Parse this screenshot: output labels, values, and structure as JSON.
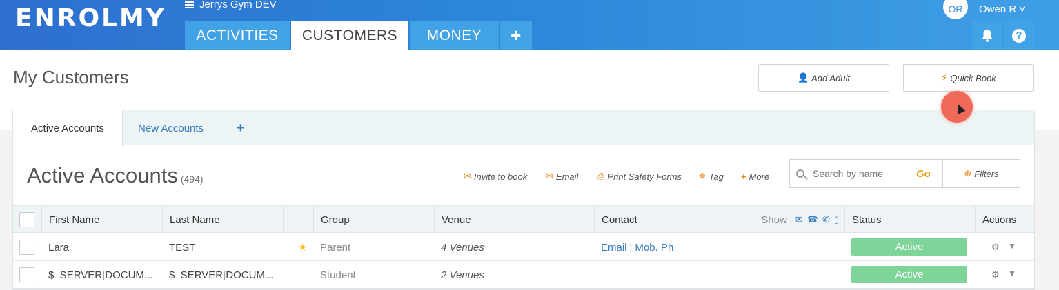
{
  "header": {
    "logo": "ENROLMY",
    "org_name": "Jerrys Gym DEV",
    "tabs": [
      {
        "label": "ACTIVITIES",
        "active": false
      },
      {
        "label": "CUSTOMERS",
        "active": true
      },
      {
        "label": "MONEY",
        "active": false
      }
    ],
    "add_tab_label": "+",
    "user_initials": "OR",
    "user_name": "Owen R",
    "help_label": "?"
  },
  "page": {
    "title": "My Customers",
    "add_adult_label": "Add Adult",
    "quick_book_label": "Quick Book"
  },
  "subtabs": {
    "items": [
      {
        "label": "Active Accounts",
        "active": true
      },
      {
        "label": "New Accounts",
        "active": false
      }
    ],
    "add_label": "+"
  },
  "section": {
    "title": "Active Accounts",
    "count": "(494)",
    "actions": [
      {
        "label": "Invite to book",
        "icon": "envelope-icon"
      },
      {
        "label": "Email",
        "icon": "envelope-icon"
      },
      {
        "label": "Print Safety Forms",
        "icon": "printer-icon"
      },
      {
        "label": "Tag",
        "icon": "tag-icon"
      },
      {
        "label": "More",
        "icon": "plus-icon"
      }
    ],
    "search_placeholder": "Search by name",
    "go_label": "Go",
    "filters_label": "Filters"
  },
  "table": {
    "columns": [
      "First Name",
      "Last Name",
      "",
      "Group",
      "Venue",
      "Contact",
      "Status",
      "Actions"
    ],
    "show_label": "Show",
    "rows": [
      {
        "first": "Lara",
        "last": "TEST",
        "starred": true,
        "group": "Parent",
        "venue": "4 Venues",
        "contact_email": "Email",
        "contact_phone": "Mob. Ph",
        "status": "Active"
      },
      {
        "first": "$_SERVER[DOCUM...",
        "last": "$_SERVER[DOCUM...",
        "starred": false,
        "group": "Student",
        "venue": "2 Venues",
        "contact_email": "",
        "contact_phone": "",
        "status": "Active"
      }
    ]
  },
  "colors": {
    "header_blue": "#2f6fd0",
    "tab_blue": "#41a3e6",
    "status_green": "#7fd49a",
    "accent_orange": "#e08a1e",
    "link_blue": "#3a7bbf"
  }
}
